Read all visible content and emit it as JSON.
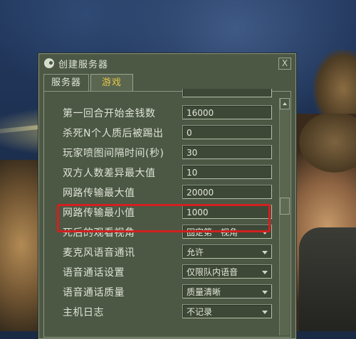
{
  "window": {
    "title": "创建服务器",
    "close_label": "X"
  },
  "tabs": [
    {
      "label": "服务器",
      "active": false
    },
    {
      "label": "游戏",
      "active": true
    }
  ],
  "settings": [
    {
      "label": "第一回合开始金钱数",
      "value": "16000",
      "type": "text"
    },
    {
      "label": "杀死N个人质后被踢出",
      "value": "0",
      "type": "text"
    },
    {
      "label": "玩家喷图间隔时间(秒)",
      "value": "30",
      "type": "text"
    },
    {
      "label": "双方人数差异最大值",
      "value": "10",
      "type": "text"
    },
    {
      "label": "网路传输最大值",
      "value": "20000",
      "type": "text"
    },
    {
      "label": "网路传输最小值",
      "value": "1000",
      "type": "text",
      "highlighted": true
    },
    {
      "label": "死后的观看视角",
      "value": "固定第一视角",
      "type": "select"
    },
    {
      "label": "麦克风语音通讯",
      "value": "允许",
      "type": "select"
    },
    {
      "label": "语音通话设置",
      "value": "仅限队内语音",
      "type": "select"
    },
    {
      "label": "语音通话质量",
      "value": "质量清晰",
      "type": "select"
    },
    {
      "label": "主机日志",
      "value": "不记录",
      "type": "select"
    }
  ],
  "colors": {
    "highlight": "#d2201f",
    "active_tab_text": "#e6c84a",
    "panel_bg": "#4c5844"
  }
}
